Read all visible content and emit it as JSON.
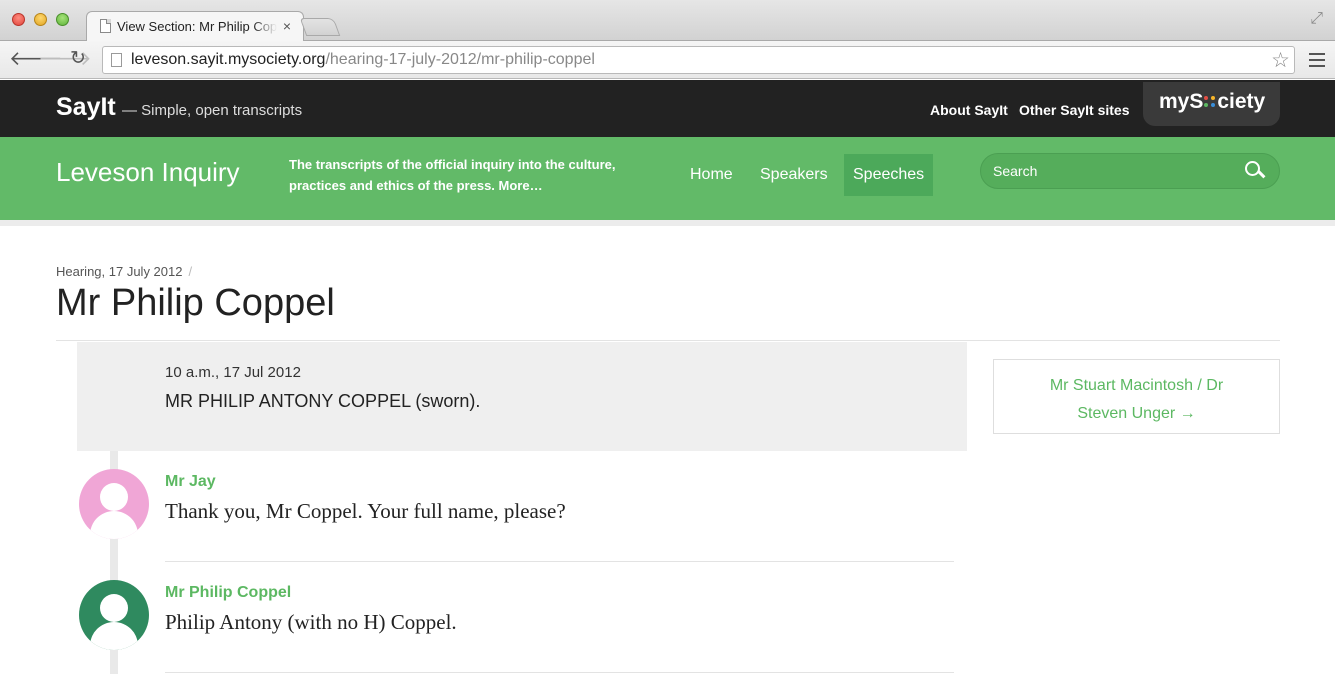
{
  "browser": {
    "tab_title": "View Section: Mr Philip Coppel",
    "tab_close": "×",
    "url_host": "leveson.sayit.mysociety.org",
    "url_path": "/hearing-17-july-2012/mr-philip-coppel"
  },
  "sayit": {
    "logo": "SayIt",
    "tagline": "— Simple, open transcripts",
    "links": [
      "About SayIt",
      "Other SayIt sites"
    ],
    "mysociety_prefix": "myS",
    "mysociety_suffix": "ciety",
    "mysociety_dot_colors": [
      "#e14d43",
      "#f7b529",
      "#5cb862",
      "#3a8fd9"
    ]
  },
  "site": {
    "title": "Leveson Inquiry",
    "description": "The transcripts of the official inquiry into the culture, practices and ethics of the press. More…",
    "nav": [
      "Home",
      "Speakers",
      "Speeches"
    ],
    "active_nav": "Speeches",
    "search_placeholder": "Search"
  },
  "page": {
    "breadcrumb": "Hearing, 17 July 2012",
    "breadcrumb_sep": "/",
    "title": "Mr Philip Coppel"
  },
  "section": {
    "time": "10 a.m., 17 Jul 2012",
    "heading": "MR PHILIP ANTONY COPPEL (sworn)."
  },
  "speeches": [
    {
      "speaker": "Mr Jay",
      "text": "Thank you, Mr Coppel. Your full name, please?",
      "avatar_color": "#f0a6d6"
    },
    {
      "speaker": "Mr Philip Coppel",
      "text": "Philip Antony (with no H) Coppel.",
      "avatar_color": "#2f8a5f"
    }
  ],
  "next_section": {
    "line1": "Mr Stuart Macintosh / Dr",
    "line2": "Steven Unger →"
  },
  "colors": {
    "brand_green": "#62ba68",
    "header_dark": "#222222",
    "link_green": "#5cb862"
  }
}
